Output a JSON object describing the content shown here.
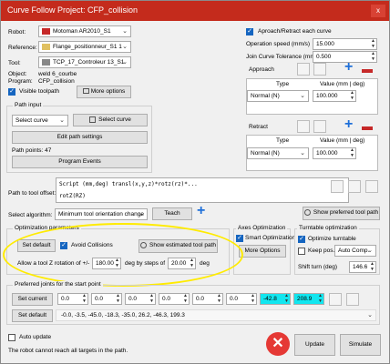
{
  "window": {
    "title": "Curve Follow Project: CFP_collision",
    "close_glyph": "x"
  },
  "left": {
    "robot_label": "Robot:",
    "robot_value": "Motoman AR2010_S1",
    "reference_label": "Reference:",
    "reference_value": "Flange_positionneur_S1 1",
    "tool_label": "Tool:",
    "tool_value": "TCP_17_Controleur 13_S1",
    "object_label": "Object:",
    "object_value": "weld 6_courbe",
    "program_label": "Program:",
    "program_value": "CFP_collision",
    "visible_toolpath": "Visible toolpath",
    "more_options": "More options"
  },
  "path_input": {
    "title": "Path input",
    "select_curve_combo": "Select curve",
    "select_curve_btn": "Select curve",
    "edit_settings": "Edit path settings",
    "points": "Path points: 47",
    "program_events": "Program Events"
  },
  "right_top": {
    "approach_retract_each": "Aproach/Retract each curve",
    "operation_speed_label": "Operation speed (mm/s)",
    "operation_speed_value": "15.000",
    "join_tol_label": "Join Curve Tolerance (mm)",
    "join_tol_value": "0.500",
    "approach_title": "Approach",
    "retract_title": "Retract",
    "col_type": "Type",
    "col_value": "Value (mm | deg)",
    "approach_row": {
      "type": "Normal (N)",
      "value": "100.000"
    },
    "retract_row": {
      "type": "Normal (N)",
      "value": "100.000"
    }
  },
  "tool_offset": {
    "label": "Path to tool offset:",
    "line1": "Script (mm,deg) transl(x,y,z)*rotz(rz)*...",
    "line2": "rotZ(RZ)"
  },
  "algorithm": {
    "label": "Select algorithm:",
    "value": "Minimum tool orientation change",
    "teach": "Teach",
    "show_preferred": "Show preferred tool path"
  },
  "optimization": {
    "title": "Optimization parameters",
    "set_default": "Set default",
    "avoid_collisions": "Avoid Collisions",
    "show_estimated": "Show estimated tool path",
    "allow_prefix": "Allow a tool Z rotation of +/-",
    "rotation_value": "180.00",
    "steps_label": "deg by steps of",
    "steps_value": "20.00",
    "deg_suffix": "deg"
  },
  "axes_opt": {
    "title": "Axes Optimization",
    "smart": "Smart Optimization",
    "more": "More Options"
  },
  "turntable": {
    "title": "Turntable optimization",
    "optimize": "Optimize turntable",
    "keep_pos": "Keep pos.",
    "keep_value": "Auto Comp.",
    "shift_label": "Shift turn (deg)",
    "shift_value": "146.6"
  },
  "preferred_joints": {
    "title": "Preferred joints for the start point",
    "set_current": "Set current",
    "joints": [
      "0.0",
      "0.0",
      "0.0",
      "0.0",
      "0.0",
      "0.0",
      "-42.8",
      "208.9"
    ],
    "set_default": "Set default",
    "default_values": "-0.0,   -3.5,   -45.0,   -18.3,   -35.0,   26.2,   -46.3,   199.3"
  },
  "footer": {
    "auto_update": "Auto update",
    "error": "The robot cannot reach all targets in the path.",
    "update": "Update",
    "simulate": "Simulate"
  },
  "colors": {
    "title_bar": "#c42b1c",
    "accent": "#1565c0",
    "highlight_oval": "#ffeb00",
    "joint_highlight": "#12e6ef",
    "error_red": "#e53935"
  }
}
